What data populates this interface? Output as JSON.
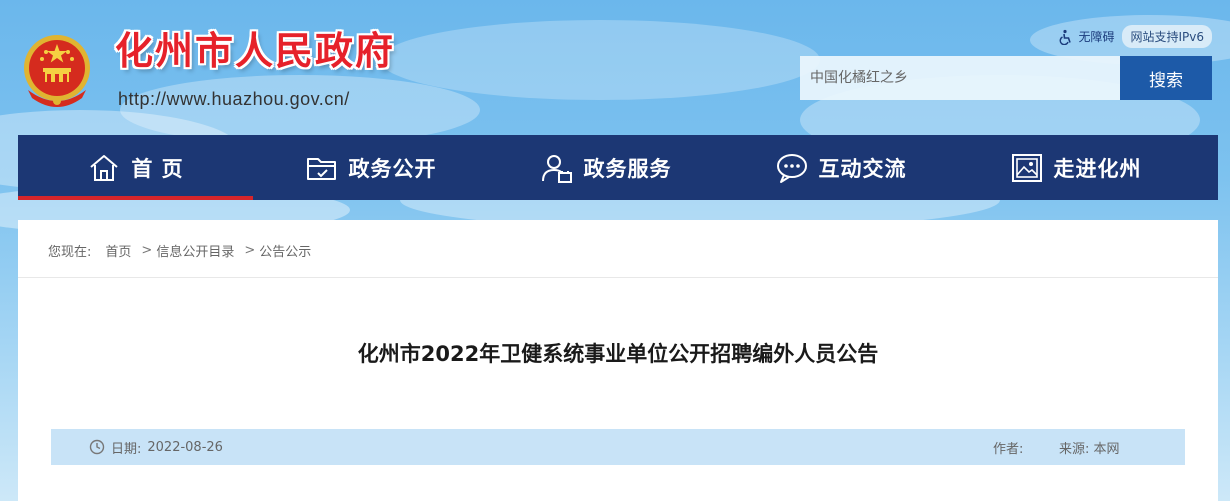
{
  "header": {
    "site_title": "化州市人民政府",
    "site_url": "http://www.huazhou.gov.cn/",
    "accessibility_label": "无障碍",
    "ipv6_label": "网站支持IPv6"
  },
  "search": {
    "placeholder": "中国化橘红之乡",
    "button_label": "搜索"
  },
  "nav": {
    "items": [
      {
        "label": "首 页",
        "icon": "home-icon"
      },
      {
        "label": "政务公开",
        "icon": "folder-icon"
      },
      {
        "label": "政务服务",
        "icon": "user-service-icon"
      },
      {
        "label": "互动交流",
        "icon": "chat-bubble-icon"
      },
      {
        "label": "走进化州",
        "icon": "picture-icon"
      }
    ],
    "active_index": 0
  },
  "breadcrumb": {
    "prefix": "您现在:",
    "items": [
      "首页",
      "信息公开目录",
      "公告公示"
    ],
    "separator": ">"
  },
  "article": {
    "title": "化州市2022年卫健系统事业单位公开招聘编外人员公告",
    "date_label": "日期:",
    "date": "2022-08-26",
    "author_label": "作者:",
    "source_label": "来源:",
    "source": "本网"
  },
  "colors": {
    "nav_bg": "#1c3774",
    "nav_active_underline": "#d6252b",
    "title_red": "#e6212a",
    "search_button": "#1d5aa8",
    "meta_bar": "#c8e3f7"
  }
}
